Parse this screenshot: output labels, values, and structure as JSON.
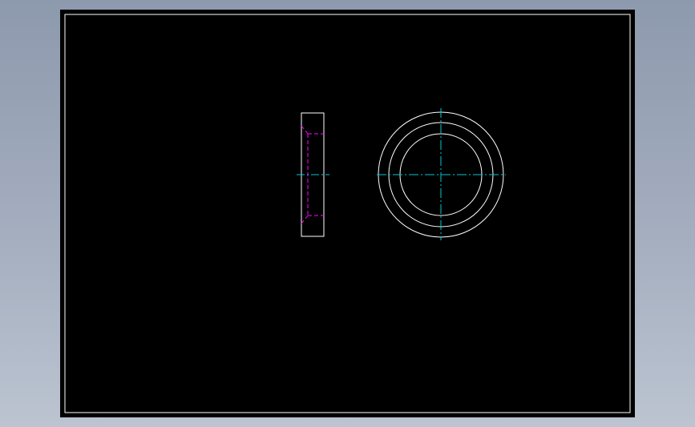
{
  "colors": {
    "background": "#98a3b5",
    "sheet": "#000000",
    "outline": "#ffffff",
    "hidden_line": "#ff00ff",
    "center_line": "#00c8d8"
  },
  "views": {
    "side_view": {
      "part": "washer",
      "projection": "side"
    },
    "front_view": {
      "part": "washer",
      "projection": "front",
      "circle_count": 3
    }
  }
}
